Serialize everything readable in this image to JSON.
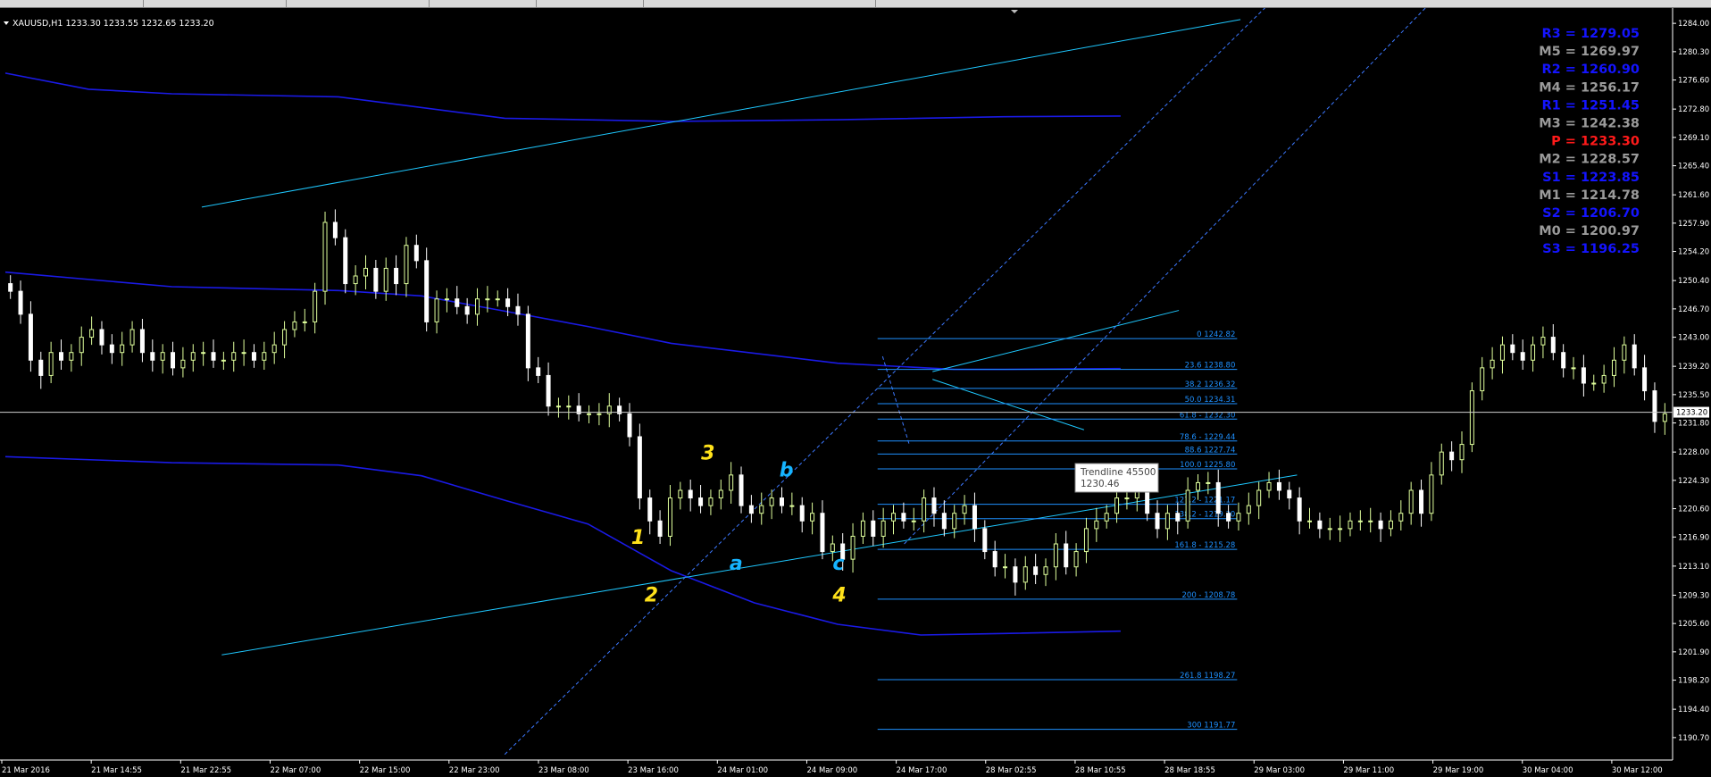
{
  "symbol_info": "XAUUSD,H1  1233.30 1233.55 1232.65 1233.20",
  "current_price": "1233.20",
  "colors": {
    "background": "#000000",
    "bull_candle": "#dfff9c",
    "bear_candle": "#ffffff",
    "grid_axis": "#ffffff",
    "blue_line": "#1a1ae6",
    "cyan_line": "#1ec8ff",
    "fib_line": "#1e90ff",
    "wave_yellow": "#ffe11a",
    "wave_cyan": "#16b4ff",
    "pivot_gray": "#9a9a9a",
    "pivot_blue": "#1414ff",
    "pivot_red": "#ff1a1a"
  },
  "chart_data": {
    "type": "candlestick",
    "timeframe": "H1",
    "y_axis": {
      "ylim": [
        1188.0,
        1286.0
      ],
      "ticks": [
        "1284.00",
        "1280.30",
        "1276.60",
        "1272.80",
        "1269.10",
        "1265.40",
        "1261.60",
        "1257.90",
        "1254.20",
        "1250.40",
        "1246.70",
        "1243.00",
        "1239.20",
        "1235.50",
        "1231.80",
        "1228.00",
        "1224.30",
        "1220.60",
        "1216.90",
        "1213.10",
        "1209.30",
        "1205.60",
        "1201.90",
        "1198.20",
        "1194.40",
        "1190.70"
      ]
    },
    "x_axis": {
      "ticks": [
        "21 Mar 2016",
        "21 Mar 14:55",
        "21 Mar 22:55",
        "22 Mar 07:00",
        "22 Mar 15:00",
        "22 Mar 23:00",
        "23 Mar 08:00",
        "23 Mar 16:00",
        "24 Mar 01:00",
        "24 Mar 09:00",
        "24 Mar 17:00",
        "28 Mar 02:55",
        "28 Mar 10:55",
        "28 Mar 18:55",
        "29 Mar 03:00",
        "29 Mar 11:00",
        "29 Mar 19:00",
        "30 Mar 04:00",
        "30 Mar 12:00"
      ]
    },
    "closes": [
      1249,
      1246,
      1240,
      1238,
      1241,
      1240,
      1241,
      1243,
      1244,
      1242,
      1241,
      1242,
      1244,
      1241,
      1240,
      1241,
      1239,
      1240,
      1241,
      1241,
      1240,
      1240,
      1241,
      1241,
      1240,
      1241,
      1242,
      1244,
      1245,
      1245,
      1249,
      1258,
      1256,
      1250,
      1251,
      1252,
      1249,
      1252,
      1250,
      1255,
      1253,
      1245,
      1248,
      1248,
      1247,
      1246,
      1248,
      1248,
      1248,
      1247,
      1246,
      1239,
      1238,
      1234,
      1234,
      1234,
      1233,
      1233,
      1233,
      1234,
      1233,
      1230,
      1222,
      1219,
      1217,
      1222,
      1223,
      1222,
      1221,
      1222,
      1223,
      1225,
      1221,
      1220,
      1221,
      1222,
      1221,
      1221,
      1219,
      1220,
      1215,
      1216,
      1214,
      1217,
      1219,
      1217,
      1219,
      1220,
      1219,
      1219,
      1222,
      1220,
      1218,
      1220,
      1221,
      1218,
      1215,
      1213,
      1213,
      1211,
      1213,
      1212,
      1213,
      1216,
      1213,
      1215,
      1218,
      1219,
      1220,
      1222,
      1222,
      1223,
      1220,
      1218,
      1220,
      1219,
      1223,
      1224,
      1224,
      1220,
      1219,
      1220,
      1221,
      1223,
      1224,
      1223,
      1222,
      1219,
      1219,
      1218,
      1218,
      1218,
      1219,
      1219,
      1219,
      1218,
      1219,
      1220,
      1223,
      1220,
      1225,
      1228,
      1227,
      1229,
      1236,
      1239,
      1240,
      1242,
      1241,
      1240,
      1242,
      1243,
      1241,
      1239,
      1239,
      1237,
      1237,
      1238,
      1240,
      1242,
      1239,
      1236,
      1232,
      1233
    ],
    "moving_averages": [
      {
        "label": "upper band",
        "x_frac": [
          0,
          0.05,
          0.1,
          0.2,
          0.3,
          0.4,
          0.5,
          0.6,
          0.67
        ],
        "y": [
          1277.5,
          1275.4,
          1274.8,
          1274.4,
          1271.6,
          1271.2,
          1271.4,
          1271.8,
          1271.9
        ]
      },
      {
        "label": "middle band",
        "x_frac": [
          0,
          0.1,
          0.2,
          0.25,
          0.3,
          0.35,
          0.4,
          0.5,
          0.57,
          0.6,
          0.67
        ],
        "y": [
          1251.5,
          1249.6,
          1249.1,
          1248.4,
          1246.4,
          1244.4,
          1242.2,
          1239.6,
          1238.8,
          1238.8,
          1238.9
        ]
      },
      {
        "label": "lower band",
        "x_frac": [
          0,
          0.1,
          0.2,
          0.25,
          0.3,
          0.35,
          0.4,
          0.45,
          0.5,
          0.55,
          0.6,
          0.67
        ],
        "y": [
          1227.4,
          1226.6,
          1226.3,
          1224.9,
          1221.7,
          1218.6,
          1212.5,
          1208.3,
          1205.5,
          1204.1,
          1204.3,
          1204.6
        ]
      }
    ],
    "fibonacci": {
      "levels": [
        {
          "label": "0 1242.82",
          "value": 1242.82
        },
        {
          "label": "23.6 1238.80",
          "value": 1238.8
        },
        {
          "label": "38.2 1236.32",
          "value": 1236.32
        },
        {
          "label": "50.0 1234.31",
          "value": 1234.31
        },
        {
          "label": "61.8 - 1232.30",
          "value": 1232.3
        },
        {
          "label": "78.6 - 1229.44",
          "value": 1229.44
        },
        {
          "label": "88.6 1227.74",
          "value": 1227.74
        },
        {
          "label": "100.0 1225.80",
          "value": 1225.8
        },
        {
          "label": "127.2 - 1221.17",
          "value": 1221.17
        },
        {
          "label": "138.2 - 1219.30",
          "value": 1219.3
        },
        {
          "label": "161.8 - 1215.28",
          "value": 1215.28
        },
        {
          "label": "200 - 1208.78",
          "value": 1208.78
        },
        {
          "label": "261.8 1198.27",
          "value": 1198.27
        },
        {
          "label": "300 1191.77",
          "value": 1191.77
        }
      ]
    },
    "tooltip": {
      "title": "Trendline 45500",
      "value": "1230.46"
    },
    "wave_labels": [
      {
        "text": "1",
        "color": "yellow",
        "x_frac": 0.376,
        "y": 1216.0
      },
      {
        "text": "2",
        "color": "yellow",
        "x_frac": 0.384,
        "y": 1208.5
      },
      {
        "text": "3",
        "color": "yellow",
        "x_frac": 0.418,
        "y": 1227.0
      },
      {
        "text": "4",
        "color": "yellow",
        "x_frac": 0.497,
        "y": 1208.5
      },
      {
        "text": "a",
        "color": "cyan",
        "x_frac": 0.435,
        "y": 1212.6
      },
      {
        "text": "b",
        "color": "cyan",
        "x_frac": 0.465,
        "y": 1224.8
      },
      {
        "text": "c",
        "color": "cyan",
        "x_frac": 0.497,
        "y": 1212.6
      }
    ]
  },
  "pivots": [
    {
      "label": "R3",
      "value": "1279.05",
      "color": "blue"
    },
    {
      "label": "M5",
      "value": "1269.97",
      "color": "gray"
    },
    {
      "label": "R2",
      "value": "1260.90",
      "color": "blue"
    },
    {
      "label": "M4",
      "value": "1256.17",
      "color": "gray"
    },
    {
      "label": "R1",
      "value": "1251.45",
      "color": "blue"
    },
    {
      "label": "M3",
      "value": "1242.38",
      "color": "gray"
    },
    {
      "label": "P ",
      "value": "1233.30",
      "color": "red"
    },
    {
      "label": "M2",
      "value": "1228.57",
      "color": "gray"
    },
    {
      "label": "S1",
      "value": "1223.85",
      "color": "blue"
    },
    {
      "label": "M1",
      "value": "1214.78",
      "color": "gray"
    },
    {
      "label": "S2",
      "value": "1206.70",
      "color": "blue"
    },
    {
      "label": "M0",
      "value": "1200.97",
      "color": "gray"
    },
    {
      "label": "S3",
      "value": "1196.25",
      "color": "blue"
    }
  ]
}
